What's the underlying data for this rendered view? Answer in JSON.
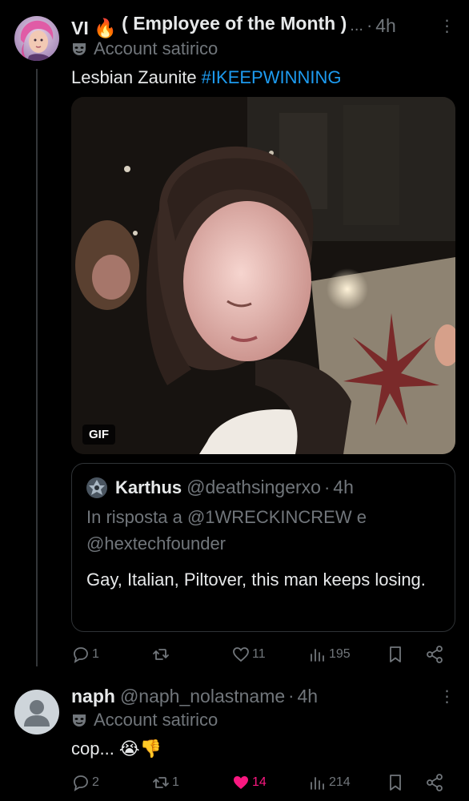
{
  "posts": [
    {
      "display_name": "VI",
      "display_name_suffix": "( Employee of the Month )",
      "name_ellipsis": "...",
      "time": "4h",
      "label": "Account satirico",
      "text_plain": "Lesbian Zaunite ",
      "text_hashtag": "#IKEEPWINNING",
      "media_badge": "GIF",
      "quote": {
        "name": "Karthus",
        "handle": "@deathsingerxo",
        "time": "4h",
        "reply_to": "In risposta a @1WRECKINCREW e @hextechfounder",
        "text": "Gay, Italian, Piltover, this man keeps losing."
      },
      "stats": {
        "replies": "1",
        "reposts": "",
        "likes": "11",
        "views": "195"
      }
    },
    {
      "display_name": "naph",
      "handle": "@naph_nolastname",
      "time": "4h",
      "label": "Account satirico",
      "text": "cop... 😭👎",
      "stats": {
        "replies": "2",
        "reposts": "1",
        "likes": "14",
        "views": "214"
      }
    }
  ],
  "icons": {
    "fire": "fire-emoji",
    "mask": "mask-icon",
    "reply": "reply-icon",
    "repost": "repost-icon",
    "like": "heart-icon",
    "views": "views-icon",
    "bookmark": "bookmark-icon",
    "share": "share-icon"
  },
  "colors": {
    "background": "#000000",
    "text": "#e7e9ea",
    "secondary": "#71767b",
    "link": "#1d9bf0",
    "like_active": "#f91880",
    "border": "#2f3336"
  }
}
